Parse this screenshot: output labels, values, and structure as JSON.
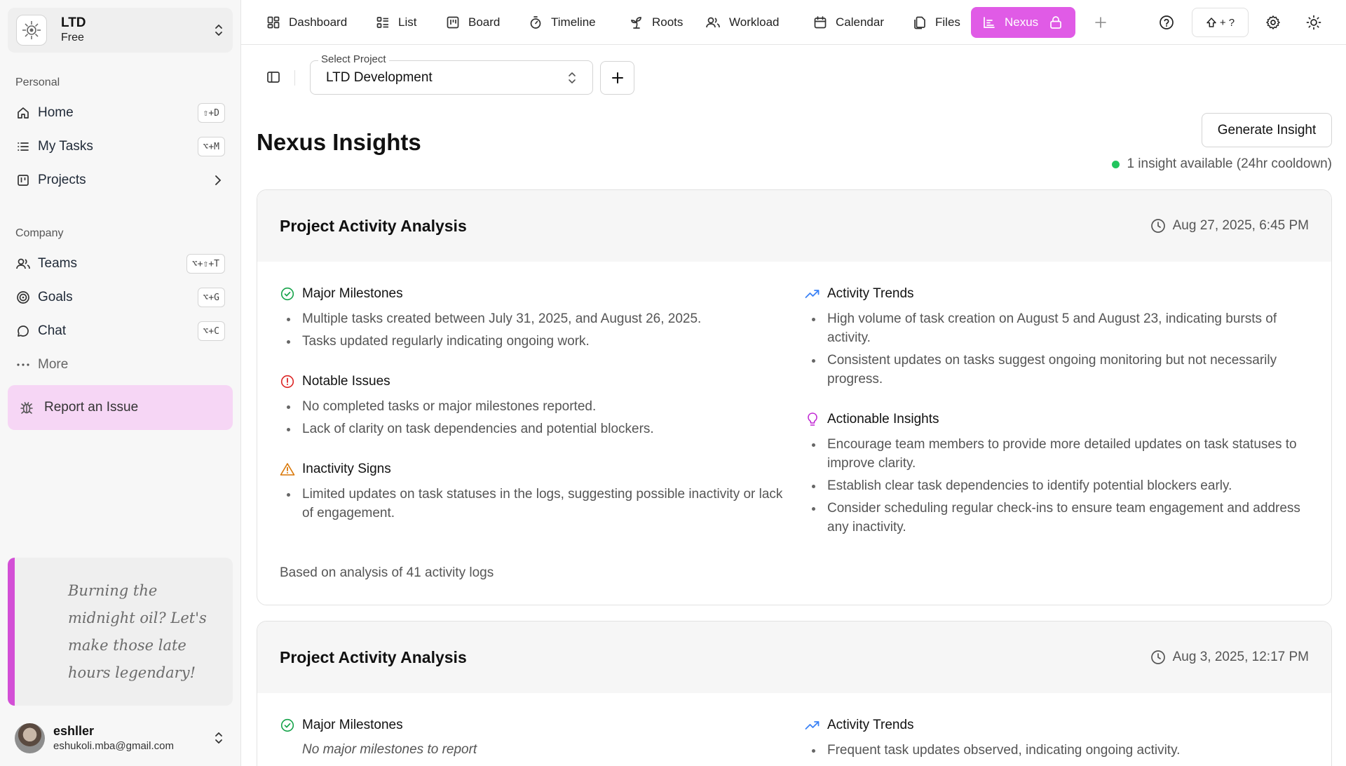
{
  "workspace": {
    "name": "LTD",
    "plan": "Free"
  },
  "sidebar": {
    "personal_label": "Personal",
    "personal": [
      {
        "label": "Home",
        "shortcut": "⇧+D"
      },
      {
        "label": "My Tasks",
        "shortcut": "⌥+M"
      },
      {
        "label": "Projects"
      }
    ],
    "company_label": "Company",
    "company": [
      {
        "label": "Teams",
        "shortcut": "⌥+⇧+T"
      },
      {
        "label": "Goals",
        "shortcut": "⌥+G"
      },
      {
        "label": "Chat",
        "shortcut": "⌥+C"
      }
    ],
    "more_label": "More",
    "report_label": "Report an Issue",
    "quote": "Burning the midnight oil? Let's make those late hours legendary!",
    "user": {
      "name": "eshller",
      "email": "eshukoli.mba@gmail.com"
    }
  },
  "topbar": {
    "tabs": [
      {
        "label": "Dashboard",
        "icon": "dashboard-icon"
      },
      {
        "label": "List",
        "icon": "list-icon"
      },
      {
        "label": "Board",
        "icon": "board-icon"
      },
      {
        "label": "Timeline",
        "icon": "stopwatch-icon"
      },
      {
        "label": "Roots",
        "icon": "sprout-icon"
      },
      {
        "label": "Workload",
        "icon": "users-icon"
      },
      {
        "label": "Calendar",
        "icon": "calendar-icon"
      },
      {
        "label": "Files",
        "icon": "files-icon"
      },
      {
        "label": "Nexus",
        "icon": "chart-icon",
        "active": true,
        "locked": true
      }
    ],
    "shortcut_label": "+ ?"
  },
  "toolbar": {
    "select_label": "Select Project",
    "select_value": "LTD Development"
  },
  "page": {
    "title": "Nexus Insights",
    "generate_label": "Generate Insight",
    "status": "1 insight available (24hr cooldown)"
  },
  "insights": [
    {
      "title": "Project Activity Analysis",
      "timestamp": "Aug 27, 2025, 6:45 PM",
      "milestones": {
        "heading": "Major Milestones",
        "items": [
          "Multiple tasks created between July 31, 2025, and August 26, 2025.",
          "Tasks updated regularly indicating ongoing work."
        ]
      },
      "issues": {
        "heading": "Notable Issues",
        "items": [
          "No completed tasks or major milestones reported.",
          "Lack of clarity on task dependencies and potential blockers."
        ]
      },
      "inactivity": {
        "heading": "Inactivity Signs",
        "items": [
          "Limited updates on task statuses in the logs, suggesting possible inactivity or lack of engagement."
        ]
      },
      "trends": {
        "heading": "Activity Trends",
        "items": [
          "High volume of task creation on August 5 and August 23, indicating bursts of activity.",
          "Consistent updates on tasks suggest ongoing monitoring but not necessarily progress."
        ]
      },
      "actionable": {
        "heading": "Actionable Insights",
        "items": [
          "Encourage team members to provide more detailed updates on task statuses to improve clarity.",
          "Establish clear task dependencies to identify potential blockers early.",
          "Consider scheduling regular check-ins to ensure team engagement and address any inactivity."
        ]
      },
      "footnote": "Based on analysis of 41 activity logs"
    },
    {
      "title": "Project Activity Analysis",
      "timestamp": "Aug 3, 2025, 12:17 PM",
      "milestones": {
        "heading": "Major Milestones",
        "empty": "No major milestones to report"
      },
      "trends": {
        "heading": "Activity Trends",
        "items": [
          "Frequent task updates observed, indicating ongoing activity."
        ]
      }
    }
  ],
  "colors": {
    "accent": "#e05be6",
    "report_bg": "#f6d6f5",
    "success": "#16a34a",
    "danger": "#dc2626",
    "warning": "#d97706",
    "trend": "#3b82f6",
    "insight": "#c026d3"
  }
}
